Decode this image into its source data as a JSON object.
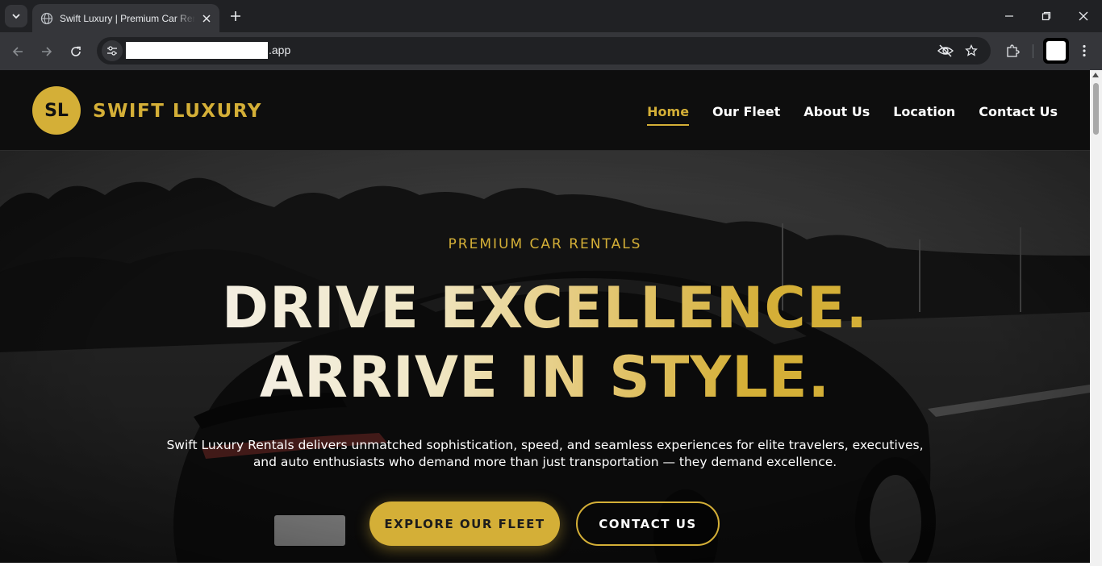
{
  "browser": {
    "tab_title": "Swift Luxury | Premium Car Rentals",
    "url_suffix": ".app"
  },
  "site": {
    "logo_initials": "SL",
    "logo_text": "SWIFT LUXURY",
    "nav": [
      {
        "label": "Home",
        "active": true
      },
      {
        "label": "Our Fleet",
        "active": false
      },
      {
        "label": "About Us",
        "active": false
      },
      {
        "label": "Location",
        "active": false
      },
      {
        "label": "Contact Us",
        "active": false
      }
    ]
  },
  "hero": {
    "eyebrow": "PREMIUM CAR RENTALS",
    "headline_line1": "DRIVE EXCELLENCE.",
    "headline_line2": "ARRIVE IN STYLE.",
    "description": "Swift Luxury Rentals delivers unmatched sophistication, speed, and seamless experiences for elite travelers, executives, and auto enthusiasts who demand more than just transportation — they demand excellence.",
    "primary_button": "EXPLORE OUR FLEET",
    "secondary_button": "CONTACT US"
  },
  "colors": {
    "accent_gold": "#d4af37",
    "header_bg": "#0e0e0e",
    "chrome_dark": "#202124",
    "chrome_toolbar": "#35363a"
  }
}
